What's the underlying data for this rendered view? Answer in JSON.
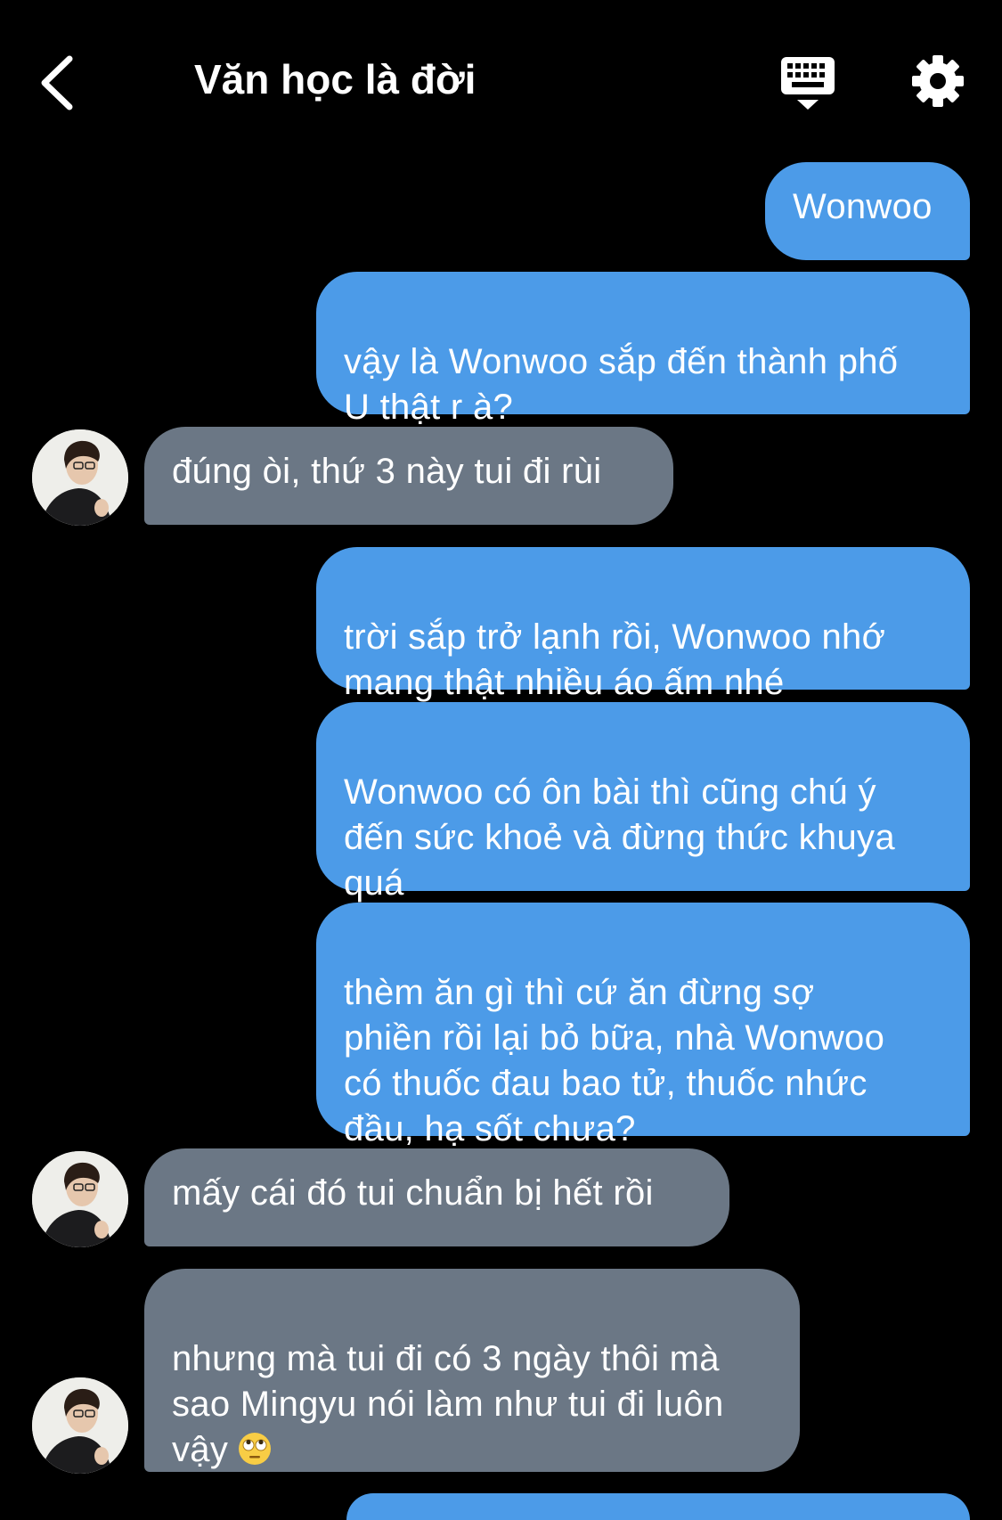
{
  "header": {
    "title": "Văn học là đời",
    "back_icon": "chevron-left-icon",
    "keyboard_icon": "keyboard-icon",
    "settings_icon": "gear-icon"
  },
  "colors": {
    "background": "#000000",
    "outgoing_bubble": "#4c9be8",
    "incoming_bubble": "#6b7785"
  },
  "messages": [
    {
      "side": "out",
      "text": "Wonwoo"
    },
    {
      "side": "out",
      "text": "vậy là Wonwoo sắp đến thành phố\nU thật r à?"
    },
    {
      "side": "in",
      "text": "đúng òi, thứ 3 này tui đi rùi"
    },
    {
      "side": "out",
      "text": "trời sắp trở lạnh rồi, Wonwoo nhớ\nmang thật nhiều áo ấm nhé"
    },
    {
      "side": "out",
      "text": "Wonwoo có ôn bài thì cũng chú ý\nđến sức khoẻ và đừng thức khuya\nquá"
    },
    {
      "side": "out",
      "text": "thèm ăn gì thì cứ ăn đừng sợ\nphiền rồi lại bỏ bữa, nhà Wonwoo\ncó thuốc đau bao tử, thuốc nhức\nđầu, hạ sốt chưa?"
    },
    {
      "side": "in",
      "text": "mấy cái đó tui chuẩn bị hết rồi"
    },
    {
      "side": "in",
      "text": "nhưng mà tui đi có 3 ngày thôi mà\nsao Mingyu nói làm như tui đi luôn\nvậy",
      "emoji": "face-with-rolling-eyes-icon"
    }
  ]
}
